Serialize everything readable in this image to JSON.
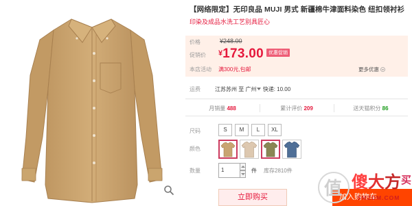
{
  "product": {
    "title": "【网络限定】无印良品 MUJI 男式 新疆棉牛津面料染色 纽扣领衬衫",
    "subtitle": "印染及成品水洗工艺别具匠心"
  },
  "pricing": {
    "original_label": "价格",
    "original_price": "¥248.00",
    "promo_label": "促销价",
    "currency_symbol": "¥",
    "promo_price": "173.00",
    "promo_tag": "优惠促销",
    "store_event_label": "本店活动",
    "store_event": "满300元,包邮",
    "more_label": "更多优惠"
  },
  "shipping": {
    "label": "运费",
    "from": "江苏苏州",
    "to_word": "至",
    "to": "广州",
    "method": "快递: 10.00"
  },
  "stats": [
    {
      "label": "月销量",
      "value": "488"
    },
    {
      "label": "累计评价",
      "value": "209"
    },
    {
      "label": "送天猫积分",
      "value": "86"
    }
  ],
  "size": {
    "label": "尺码",
    "options": [
      "S",
      "M",
      "L",
      "XL"
    ]
  },
  "color": {
    "label": "颜色",
    "swatches": [
      {
        "name": "khaki",
        "color": "#c9a572",
        "selected": true
      },
      {
        "name": "beige",
        "color": "#ddc8b0",
        "selected": false
      },
      {
        "name": "olive",
        "color": "#8a8654",
        "selected": true
      },
      {
        "name": "blue",
        "color": "#4f6f97",
        "selected": false
      }
    ]
  },
  "quantity": {
    "label": "数量",
    "value": "1",
    "unit": "件",
    "stock": "库存2810件"
  },
  "actions": {
    "buy_now": "立即购买",
    "add_to_cart": "加入购物车"
  },
  "watermark": {
    "brand": "值",
    "text_1": "傻",
    "text_2": "大",
    "text_3": "方",
    "text_4": "买",
    "url": "SMZDM.COM"
  },
  "colors": {
    "accent_red": "#e5183c",
    "cart_orange": "#ff4400",
    "price_bg": "#fff0e8",
    "shirt": "#c9a36c"
  }
}
